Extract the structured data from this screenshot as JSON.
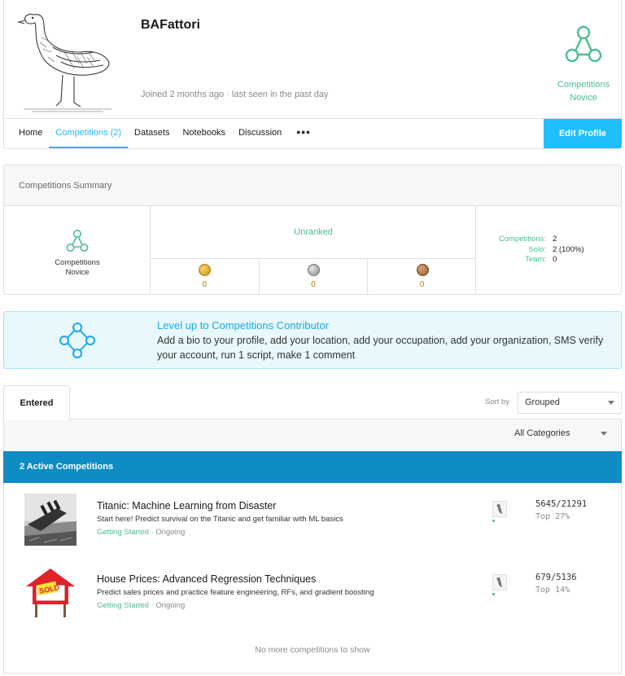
{
  "profile": {
    "username": "BAFattori",
    "joined": "Joined 2 months ago · last seen in the past day",
    "avatar_icon": "goose-illustration",
    "tier": "Competitions Novice",
    "tier_line1": "Competitions",
    "tier_line2": "Novice"
  },
  "nav": {
    "items": [
      "Home",
      "Competitions (2)",
      "Datasets",
      "Notebooks",
      "Discussion"
    ],
    "more": "•••",
    "active_index": 1,
    "edit_profile": "Edit Profile"
  },
  "summary": {
    "title": "Competitions Summary",
    "tier_line1": "Competitions",
    "tier_line2": "Novice",
    "rank": "Unranked",
    "medals": {
      "gold": {
        "count": "0",
        "color": "#d5a021"
      },
      "silver": {
        "count": "0",
        "color": "#9b9b9b"
      },
      "bronze": {
        "count": "0",
        "color": "#a0673b"
      }
    },
    "stats": [
      {
        "key": "Competitions:",
        "value": "2"
      },
      {
        "key": "Solo:",
        "value": "2 (100%)"
      },
      {
        "key": "Team:",
        "value": "0"
      }
    ]
  },
  "levelup": {
    "title": "Level up to Competitions Contributor",
    "text": "Add a bio to your profile, add your location, add your occupation, add your organization, SMS verify your account, run 1 script, make 1 comment"
  },
  "competitions": {
    "tab": "Entered",
    "sort_label": "Sort by",
    "sort_value": "Grouped",
    "category_value": "All Categories",
    "active_header": "2 Active Competitions",
    "items": [
      {
        "title": "Titanic: Machine Learning from Disaster",
        "description": "Start here! Predict survival on the Titanic and get familiar with ML basics",
        "category": "Getting Started",
        "status": "· Ongoing",
        "rank": "5645/21291",
        "top": "Top 27%",
        "thumb_icon": "titanic-thumbnail"
      },
      {
        "title": "House Prices: Advanced Regression Techniques",
        "description": "Predict sales prices and practice feature engineering, RFs, and gradient boosting",
        "category": "Getting Started",
        "status": "· Ongoing",
        "rank": "679/5136",
        "top": "Top 14%",
        "thumb_icon": "house-sold-thumbnail",
        "sold_sign": "SOLD"
      }
    ],
    "no_more": "No more competitions to show"
  },
  "colors": {
    "accent": "#20beff",
    "green": "#4bbe8f",
    "active_bar": "#0e8cc4"
  }
}
